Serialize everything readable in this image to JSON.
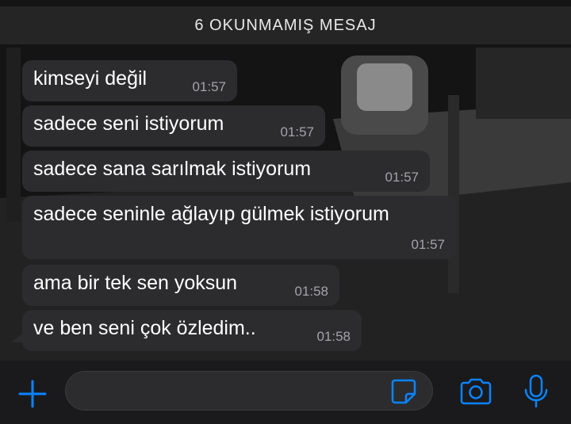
{
  "banner": {
    "label": "6 OKUNMAMIŞ MESAJ"
  },
  "messages": [
    {
      "text": "kimseyi değil",
      "time": "01:57"
    },
    {
      "text": "sadece seni istiyorum",
      "time": "01:57"
    },
    {
      "text": "sadece sana sarılmak istiyorum",
      "time": "01:57"
    },
    {
      "text": "sadece seninle ağlayıp gülmek istiyorum",
      "time": "01:57"
    },
    {
      "text": "ama bir tek sen yoksun",
      "time": "01:58"
    },
    {
      "text": "ve ben seni çok özledim..",
      "time": "01:58"
    }
  ],
  "composer": {
    "placeholder": "",
    "icons": [
      "plus-icon",
      "sticker-icon",
      "camera-icon",
      "microphone-icon"
    ],
    "accent": "#0a84ff"
  },
  "colors": {
    "bubble": "#2c2c2e",
    "text": "#ffffff",
    "timestamp": "#a3a3a8",
    "banner": "#262628"
  }
}
